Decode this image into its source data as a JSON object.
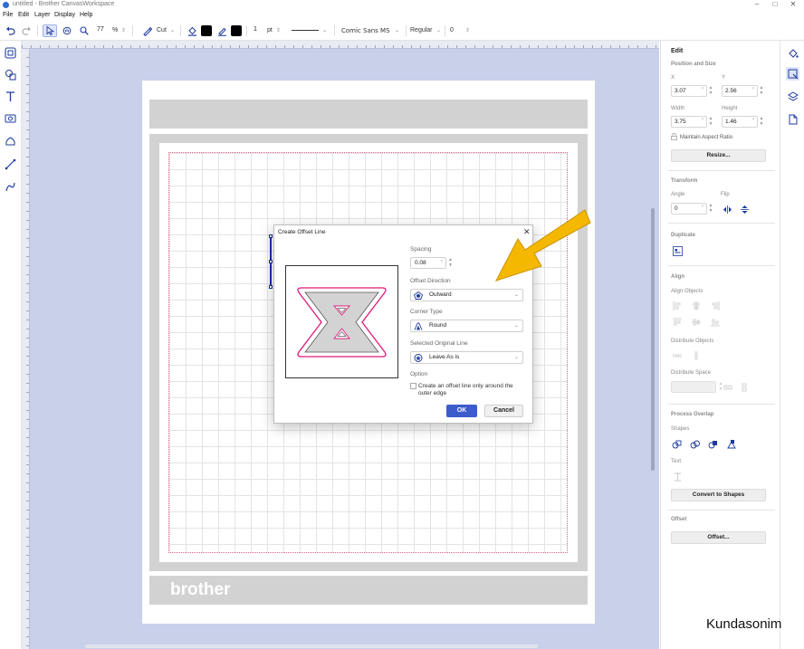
{
  "window": {
    "title": "untitled - Brother CanvasWorkspace"
  },
  "menu": [
    "File",
    "Edit",
    "Layer",
    "Display",
    "Help"
  ],
  "toolbar": {
    "zoom_value": "77",
    "zoom_unit": "%",
    "mode_label": "Cut",
    "line_width": "1",
    "line_unit": "pt",
    "font_name": "Comic Sans MS",
    "font_style": "Regular",
    "font_size": "0",
    "fill_color": "#000000",
    "line_color": "#000000"
  },
  "left_tools": [
    "select-tool-icon",
    "shapes-icon",
    "text-icon",
    "image-trace-icon",
    "library-icon",
    "line-icon",
    "pen-icon"
  ],
  "canvas": {
    "brand_text": "brother",
    "background_color": "#c8d0ea"
  },
  "dialog": {
    "title": "Create Offset Line",
    "spacing_label": "Spacing",
    "spacing_value": "0.08",
    "spacing_unit": "\"",
    "direction_label": "Offset Direction",
    "direction_value": "Outward",
    "corner_label": "Corner Type",
    "corner_value": "Round",
    "original_label": "Selected Original Line",
    "original_value": "Leave As is",
    "option_label": "Option",
    "option_checkbox_label": "Create an offset line only around the outer edge",
    "ok_label": "OK",
    "cancel_label": "Cancel",
    "offset_line_color": "#e0197a",
    "shape_fill_color": "#d3d3d3"
  },
  "annotation": {
    "arrow_color": "#f5b800"
  },
  "panel": {
    "title": "Edit",
    "position_size_label": "Position and Size",
    "x_label": "X",
    "x_value": "3.07",
    "y_label": "Y",
    "y_value": "2.56",
    "width_label": "Width",
    "width_value": "3.75",
    "height_label": "Height",
    "height_value": "1.46",
    "unit": "\"",
    "aspect_label": "Maintain Aspect Ratio",
    "resize_label": "Resize...",
    "transform_label": "Transform",
    "angle_label": "Angle",
    "angle_value": "0",
    "angle_unit": "°",
    "flip_label": "Flip",
    "duplicate_label": "Duplicate",
    "align_label": "Align",
    "align_objects_label": "Align Objects",
    "distribute_objects_label": "Distribute Objects",
    "distribute_space_label": "Distribute Space",
    "process_overlap_label": "Process Overlap",
    "shapes_label": "Shapes",
    "text_label": "Text",
    "convert_label": "Convert to Shapes",
    "offset_section_label": "Offset",
    "offset_button_label": "Offset..."
  },
  "watermark": "Kundasonim"
}
